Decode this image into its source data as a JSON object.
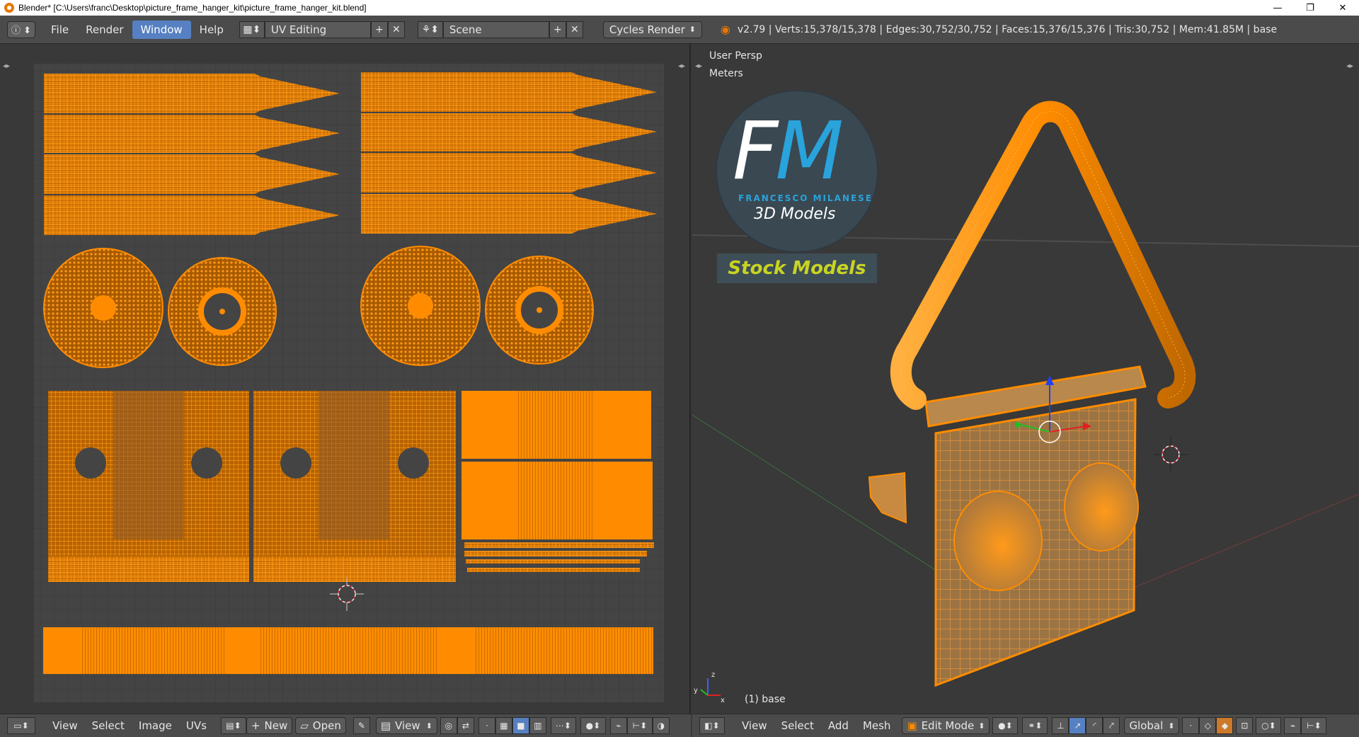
{
  "titlebar": {
    "title": "Blender* [C:\\Users\\franc\\Desktop\\picture_frame_hanger_kit\\picture_frame_hanger_kit.blend]",
    "minimize": "—",
    "maximize": "❐",
    "close": "✕"
  },
  "info_header": {
    "menus": [
      "File",
      "Render",
      "Window",
      "Help"
    ],
    "active_menu": "Window",
    "layout": "UV Editing",
    "scene": "Scene",
    "render_engine": "Cycles Render",
    "stats": "v2.79 | Verts:15,378/15,378 | Edges:30,752/30,752 | Faces:15,376/15,376 | Tris:30,752 | Mem:41.85M | base"
  },
  "uv_header": {
    "menus": [
      "View",
      "Select",
      "Image",
      "UVs"
    ],
    "new_label": "New",
    "open_label": "Open",
    "view_label": "View"
  },
  "view3d": {
    "persp_label": "User Persp",
    "units_label": "Meters",
    "object_label": "(1) base"
  },
  "view3d_header": {
    "menus": [
      "View",
      "Select",
      "Add",
      "Mesh"
    ],
    "mode": "Edit Mode",
    "orientation": "Global"
  },
  "logo": {
    "f": "F",
    "m": "M",
    "name": "FRANCESCO MILANESE",
    "subtitle": "3D Models",
    "tag": "Stock Models"
  },
  "colors": {
    "accent_orange": "#ff8a00",
    "selection_blue": "#5680c2",
    "logo_blue": "#29a3dc",
    "logo_yellow": "#c8d422"
  }
}
